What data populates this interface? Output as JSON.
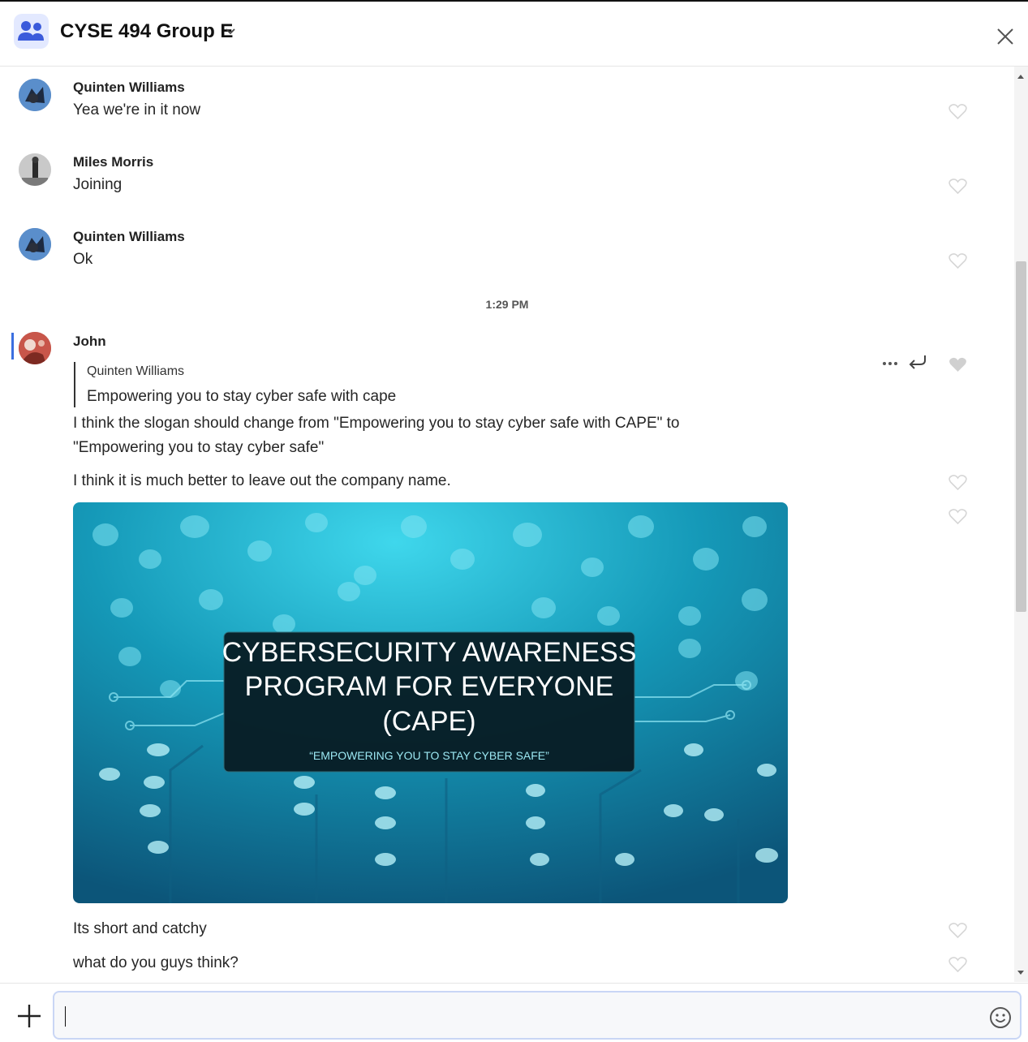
{
  "header": {
    "title": "CYSE 494 Group E"
  },
  "messages": [
    {
      "sender": "Quinten Williams",
      "text": "Yea we're in it now"
    },
    {
      "sender": "Miles Morris",
      "text": "Joining"
    },
    {
      "sender": "Quinten Williams",
      "text": "Ok"
    }
  ],
  "timestamp": "1:29 PM",
  "john": {
    "sender": "John",
    "quote_author": "Quinten Williams",
    "quote_text": "Empowering you to stay cyber safe with cape",
    "line1": "I think the slogan should change from \"Empowering you to stay cyber safe with CAPE\" to",
    "line2": "\"Empowering you to stay cyber safe\"",
    "line3": "I think it is much better to leave out the company name.",
    "image": {
      "title_line1": "CYBERSECURITY AWARENESS",
      "title_line2": "PROGRAM FOR EVERYONE",
      "title_line3": "(CAPE)",
      "slogan": "“EMPOWERING YOU TO STAY CYBER SAFE”"
    },
    "line4": "Its short and catchy",
    "line5": "what do you guys think?"
  },
  "composer": {
    "placeholder": ""
  },
  "colors": {
    "accent": "#3b6fe0",
    "group_icon_bg": "#e3e9ff",
    "image_teal": "#1aa6c4"
  },
  "icons": [
    "group-icon",
    "chevron-down-icon",
    "close-icon",
    "heart-icon",
    "more-icon",
    "reply-icon",
    "plus-icon",
    "emoji-icon"
  ]
}
